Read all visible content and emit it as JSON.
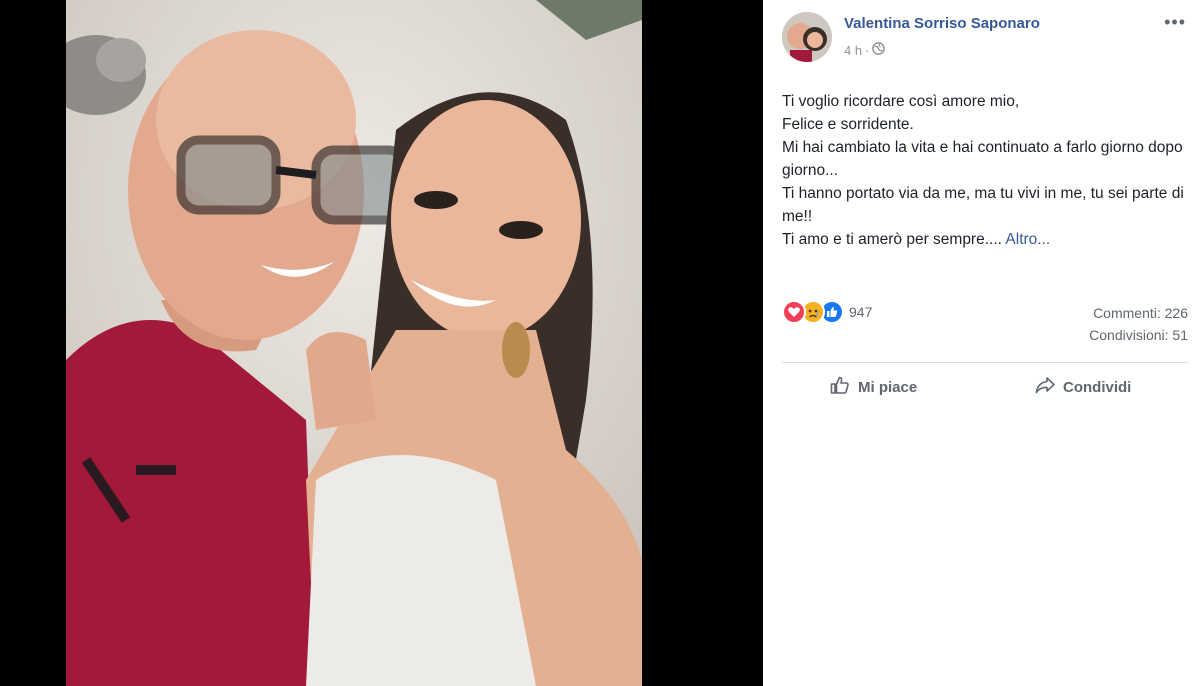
{
  "post": {
    "author": "Valentina Sorriso Saponaro",
    "time": "4 h",
    "separator": "·",
    "privacy_icon": "globe-icon",
    "more_label": "•••",
    "lines": [
      "Ti voglio ricordare così amore mio,",
      "Felice e sorridente.",
      "Mi hai cambiato la vita e hai continuato a farlo giorno dopo giorno...",
      "Ti hanno portato via da me, ma tu vivi in me, tu sei parte di me!!"
    ],
    "last_line": "Ti amo e ti amerò per sempre....",
    "more_link": "Altro..."
  },
  "reactions": {
    "icons": [
      "love-reaction-icon",
      "sad-reaction-icon",
      "like-reaction-icon"
    ],
    "colors": {
      "love": "#f33e58",
      "sad": "#f7b125",
      "like": "#1877f2"
    },
    "count": "947"
  },
  "stats": {
    "comments": "Commenti: 226",
    "shares": "Condivisioni: 51"
  },
  "actions": {
    "like_label": "Mi piace",
    "share_label": "Condividi"
  },
  "colors": {
    "link": "#385898",
    "text": "#1d2129",
    "muted": "#606770"
  }
}
